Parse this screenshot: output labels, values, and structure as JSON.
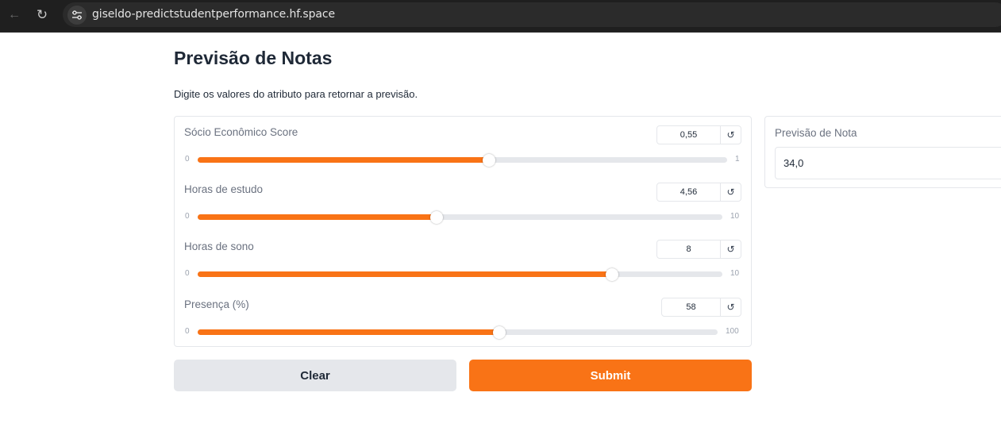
{
  "browser": {
    "url": "giseldo-predictstudentperformance.hf.space",
    "icons": {
      "back": "arrow-left-icon",
      "reload": "reload-icon",
      "site_info": "tune-icon"
    }
  },
  "page": {
    "title": "Previsão de Notas",
    "description": "Digite os valores do atributo para retornar a previsão."
  },
  "sliders": [
    {
      "label": "Sócio Econômico Score",
      "value": "0,55",
      "min": "0",
      "max": "1",
      "level": 0.55
    },
    {
      "label": "Horas de estudo",
      "value": "4,56",
      "min": "0",
      "max": "10",
      "level": 0.456
    },
    {
      "label": "Horas de sono",
      "value": "8",
      "min": "0",
      "max": "10",
      "level": 0.79
    },
    {
      "label": "Presença (%)",
      "value": "58",
      "min": "0",
      "max": "100",
      "level": 0.58
    }
  ],
  "buttons": {
    "clear": "Clear",
    "submit": "Submit"
  },
  "output": {
    "label": "Previsão de Nota",
    "value": "34,0"
  },
  "colors": {
    "accent": "#f97316",
    "secondary_button": "#e5e7eb",
    "track": "#e5e7eb"
  }
}
